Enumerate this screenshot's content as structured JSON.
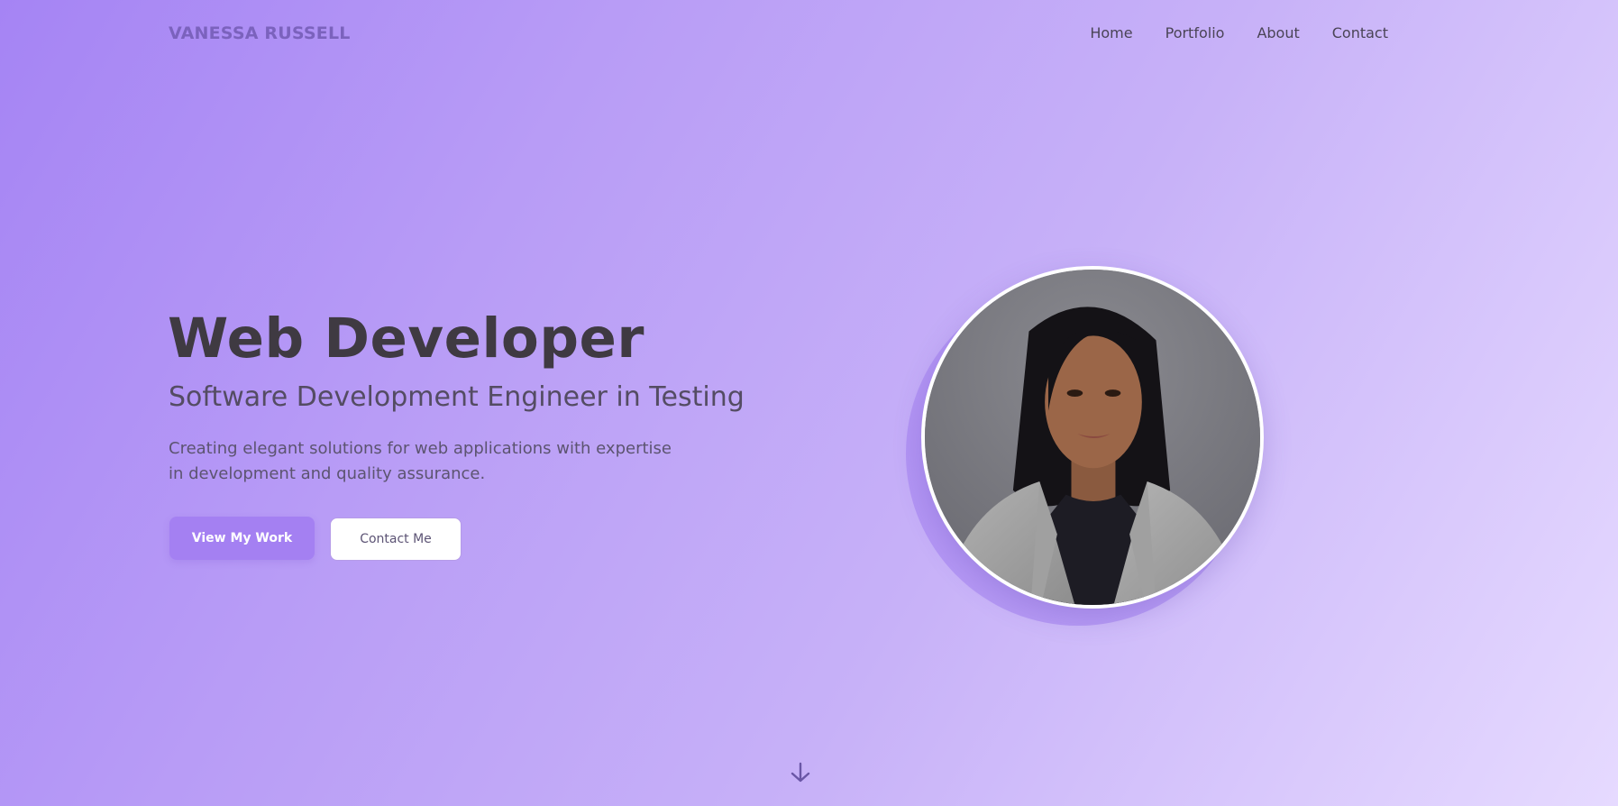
{
  "brand": {
    "name": "VANESSA RUSSELL"
  },
  "nav": {
    "items": [
      {
        "label": "Home"
      },
      {
        "label": "Portfolio"
      },
      {
        "label": "About"
      },
      {
        "label": "Contact"
      }
    ]
  },
  "hero": {
    "title": "Web Developer",
    "subtitle": "Software Development Engineer in Testing",
    "description": "Creating elegant solutions for web applications with expertise in development and quality assurance.",
    "primary_button": "View My Work",
    "secondary_button": "Contact Me",
    "portrait_icon": "profile-photo",
    "scroll_icon": "arrow-down-icon"
  },
  "colors": {
    "accent": "#a480f2",
    "logo": "#7b62bd",
    "heading": "#3f3a42"
  }
}
